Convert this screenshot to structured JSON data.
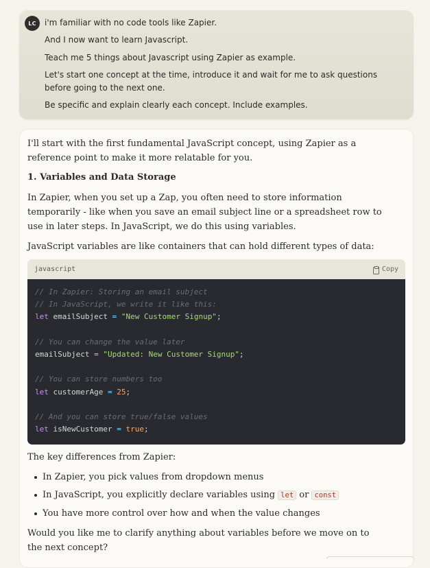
{
  "user_message": {
    "avatar_initials": "LC",
    "lines": [
      "i'm familiar with no code tools like Zapier.",
      "And I now want to learn Javascript.",
      "Teach me 5 things about Javascript using Zapier as example.",
      "Let's start one concept at the time, introduce it and wait for me to ask questions before going to the next one.",
      "Be specific and explain clearly each concept. Include examples."
    ]
  },
  "assistant": {
    "intro": "I'll start with the first fundamental JavaScript concept, using Zapier as a reference point to make it more relatable for you.",
    "heading": "1. Variables and Data Storage",
    "para1": "In Zapier, when you set up a Zap, you often need to store information temporarily - like when you save an email subject line or a spreadsheet row to use in later steps. In JavaScript, we do this using variables.",
    "para2": "JavaScript variables are like containers that can hold different types of data:",
    "code": {
      "language": "javascript",
      "copy_label": "Copy",
      "comment1": "// In Zapier: Storing an email subject",
      "comment2": "// In JavaScript, we write it like this:",
      "kw_let": "let",
      "var_email": "emailSubject",
      "op_eq": "=",
      "str1": "\"New Customer Signup\"",
      "semi": ";",
      "comment3": "// You can change the value later",
      "str2": "\"Updated: New Customer Signup\"",
      "comment4": "// You can store numbers too",
      "var_age": "customerAge",
      "num1": "25",
      "comment5": "// And you can store true/false values",
      "var_new": "isNewCustomer",
      "bool1": "true"
    },
    "key_diff": "The key differences from Zapier:",
    "bullets": {
      "b1": "In Zapier, you pick values from dropdown menus",
      "b2_prefix": "In JavaScript, you explicitly declare variables using ",
      "b2_code1": "let",
      "b2_or": " or ",
      "b2_code2": "const",
      "b3": "You have more control over how and when the value changes"
    },
    "closing": "Would you like me to clarify anything about variables before we move on to the next concept?"
  }
}
